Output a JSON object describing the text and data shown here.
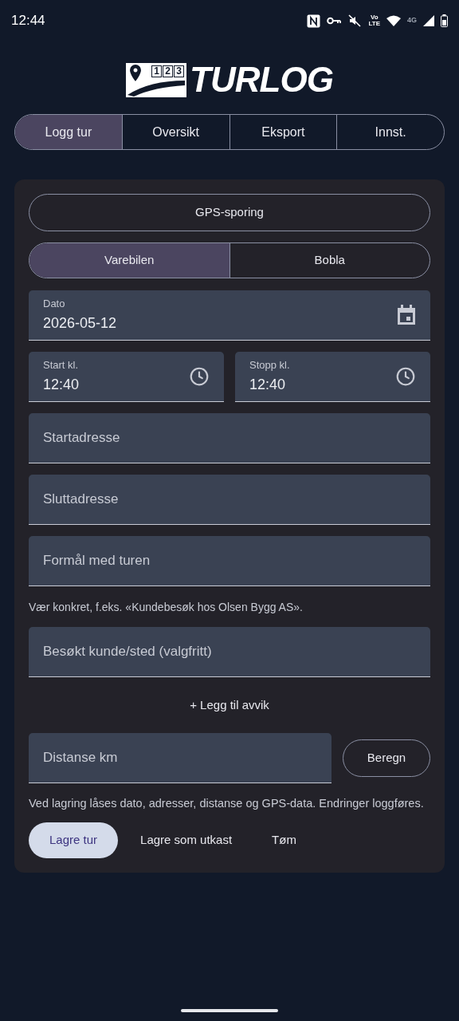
{
  "status_bar": {
    "time": "12:44",
    "volte": [
      "Vo",
      "LTE"
    ],
    "network": "4G"
  },
  "logo": {
    "badge": [
      "1",
      "2",
      "3"
    ],
    "wordmark": "TURLOG"
  },
  "tabs": [
    {
      "label": "Logg tur",
      "selected": true
    },
    {
      "label": "Oversikt",
      "selected": false
    },
    {
      "label": "Eksport",
      "selected": false
    },
    {
      "label": "Innst.",
      "selected": false
    }
  ],
  "gps_button": "GPS-sporing",
  "vehicles": [
    {
      "label": "Varebilen",
      "selected": true
    },
    {
      "label": "Bobla",
      "selected": false
    }
  ],
  "date_field": {
    "label": "Dato",
    "value": "2026-05-12"
  },
  "time_fields": [
    {
      "label": "Start kl.",
      "value": "12:40"
    },
    {
      "label": "Stopp kl.",
      "value": "12:40"
    }
  ],
  "address_fields": [
    {
      "placeholder": "Startadresse"
    },
    {
      "placeholder": "Sluttadresse"
    }
  ],
  "purpose_field": {
    "placeholder": "Formål med turen",
    "hint": "Vær konkret, f.eks. «Kundebesøk hos Olsen Bygg AS»."
  },
  "visit_field": {
    "placeholder": "Besøkt kunde/sted (valgfritt)"
  },
  "add_deviation": "+ Legg til avvik",
  "distance_field": {
    "placeholder": "Distanse km"
  },
  "calculate_button": "Beregn",
  "note": "Ved lagring låses dato, adresser, distanse og GPS-data. Endringer loggføres.",
  "actions": [
    {
      "label": "Lagre tur",
      "kind": "primary"
    },
    {
      "label": "Lagre som utkast",
      "kind": "text"
    },
    {
      "label": "Tøm",
      "kind": "text"
    }
  ]
}
